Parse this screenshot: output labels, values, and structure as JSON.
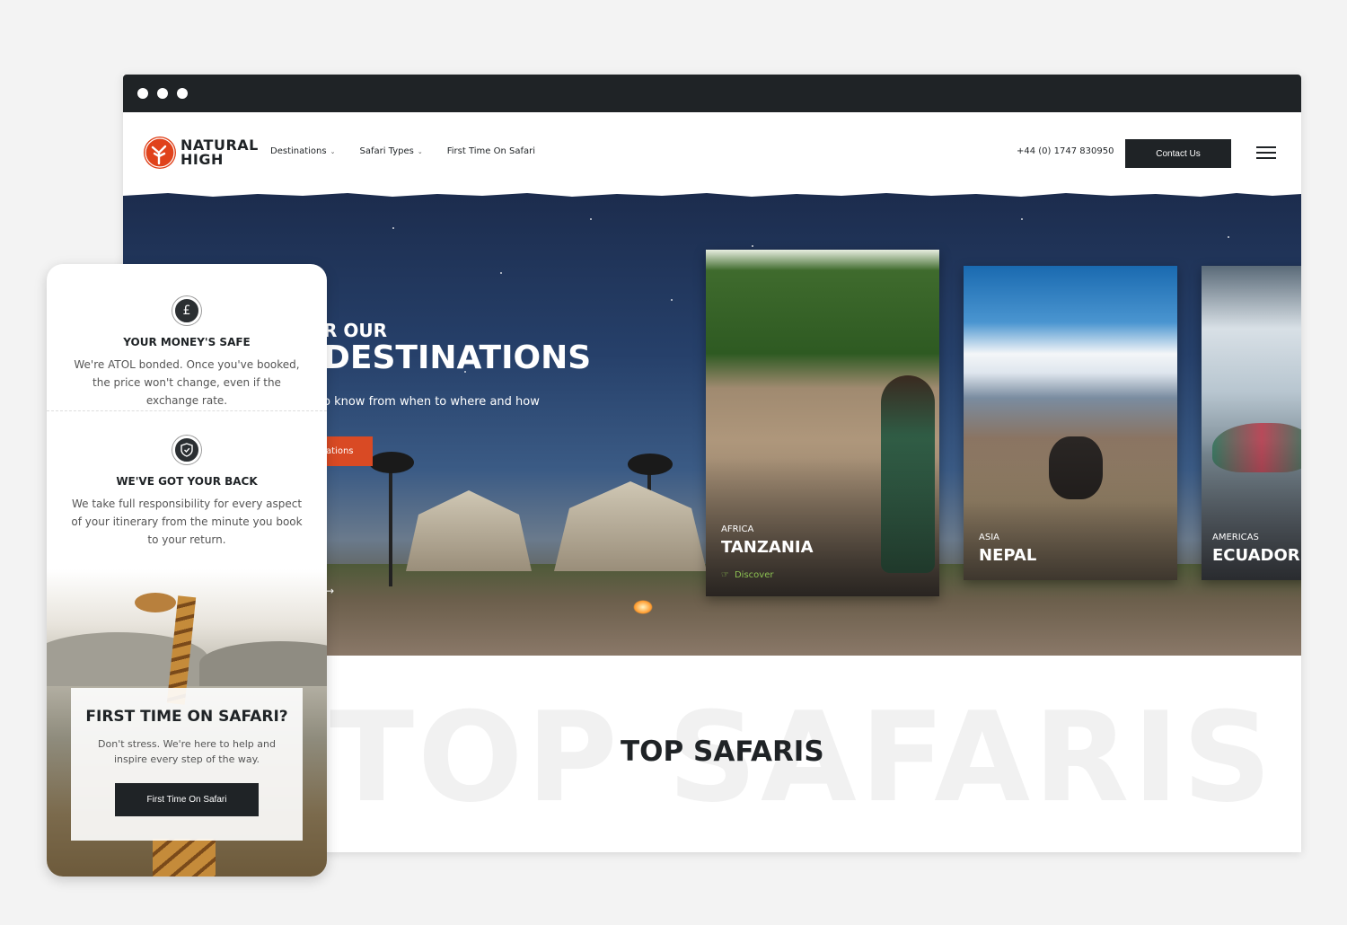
{
  "brand": {
    "name_line1": "NATURAL",
    "name_line2": "HIGH",
    "accent": "#e0421b",
    "dark": "#1f2326",
    "link_green": "#8cc152"
  },
  "nav": {
    "items": [
      {
        "label": "Destinations",
        "dropdown": true
      },
      {
        "label": "Safari Types",
        "dropdown": true
      },
      {
        "label": "First Time On Safari",
        "dropdown": false
      }
    ],
    "phone": "+44 (0) 1747 830950",
    "contact_label": "Contact Us",
    "menu_icon": "hamburger-icon"
  },
  "hero": {
    "eyebrow": "R OUR",
    "title": "DESTINATIONS",
    "subtitle": "o know from when to where and how",
    "button_label": "ations"
  },
  "cards": [
    {
      "region": "AFRICA",
      "name": "TANZANIA",
      "link": "Discover"
    },
    {
      "region": "ASIA",
      "name": "NEPAL"
    },
    {
      "region": "AMERICAS",
      "name": "ECUADOR"
    }
  ],
  "section": {
    "bg_title": "TOP SAFARIS",
    "title": "TOP SAFARIS"
  },
  "mobile": {
    "features": [
      {
        "icon": "pound-icon",
        "title": "YOUR MONEY'S SAFE",
        "text": "We're ATOL bonded. Once you've booked, the price won't change, even if the exchange rate."
      },
      {
        "icon": "shield-icon",
        "title": "WE'VE GOT YOUR BACK",
        "text": "We take full responsibility for every aspect of your itinerary from the minute you book to your return."
      }
    ],
    "safari_promo": {
      "title": "FIRST TIME ON SAFARI?",
      "text": "Don't stress. We're here to help and inspire every step of the way.",
      "button_label": "First Time On Safari"
    }
  }
}
